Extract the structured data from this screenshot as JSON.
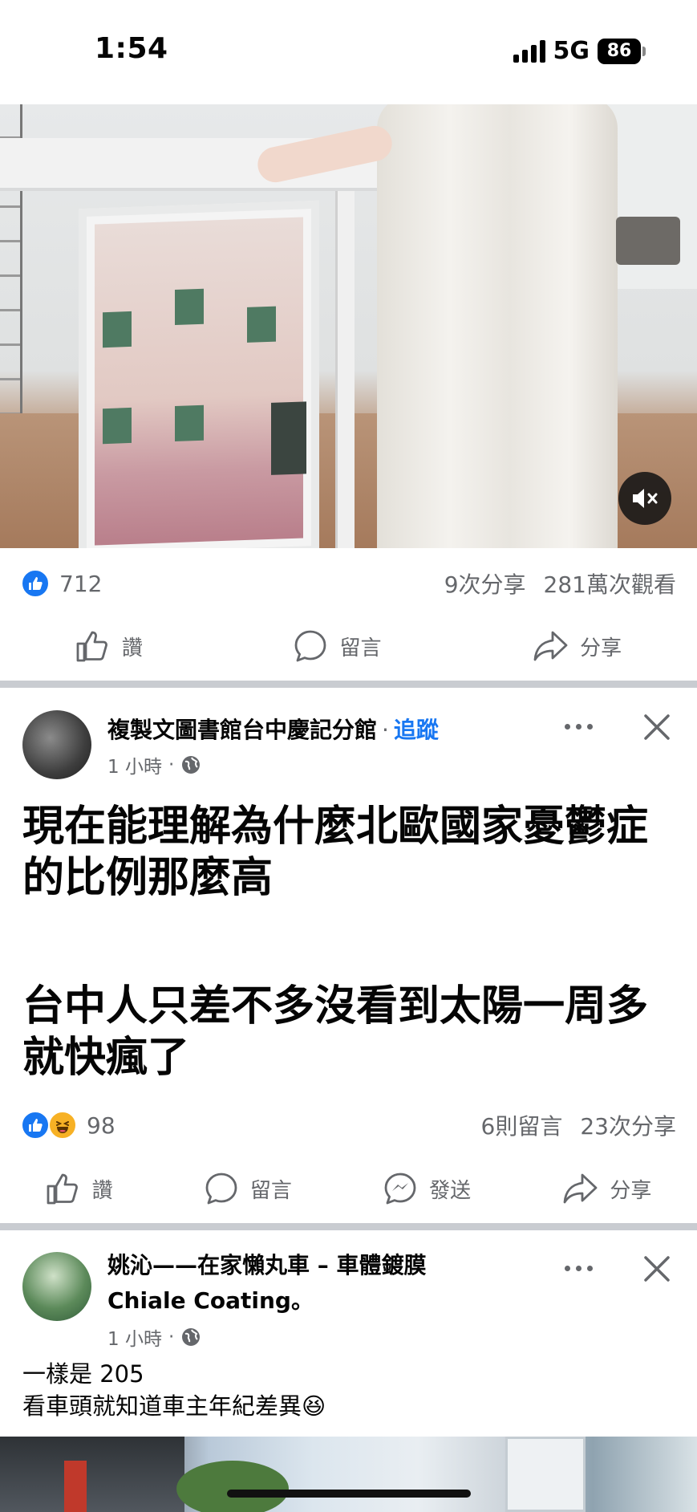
{
  "status_bar": {
    "time": "1:54",
    "network": "5G",
    "battery": "86"
  },
  "video_post": {
    "reaction_count": "712",
    "shares": "9次分享",
    "views": "281萬次觀看",
    "actions": {
      "like": "讚",
      "comment": "留言",
      "share": "分享"
    }
  },
  "post2": {
    "author": "複製文圖書館台中慶記分館",
    "separator": "·",
    "follow": "追蹤",
    "time": "1 小時",
    "meta_separator": "·",
    "text_line1": "現在能理解為什麼北歐國家憂鬱症的比例那麼高",
    "text_line2": "台中人只差不多沒看到太陽一周多就快瘋了",
    "reaction_count": "98",
    "comments": "6則留言",
    "shares": "23次分享",
    "actions": {
      "like": "讚",
      "comment": "留言",
      "send": "發送",
      "share": "分享"
    }
  },
  "post3": {
    "author_line1": "姚沁——在家懶丸車 – 車體鍍膜",
    "author_line2": "Chiale Coating。",
    "time": "1 小時",
    "meta_separator": "·",
    "text_line1": "一樣是 205",
    "text_line2": "看車頭就知道車主年紀差異😆"
  },
  "colors": {
    "facebook_blue": "#1877f2",
    "secondary_text": "#65676b",
    "divider": "#c9ccd1"
  },
  "icons": [
    "mute-icon",
    "like-icon",
    "comment-icon",
    "share-icon",
    "send-icon",
    "globe-icon",
    "more-icon",
    "close-icon",
    "haha-icon"
  ]
}
